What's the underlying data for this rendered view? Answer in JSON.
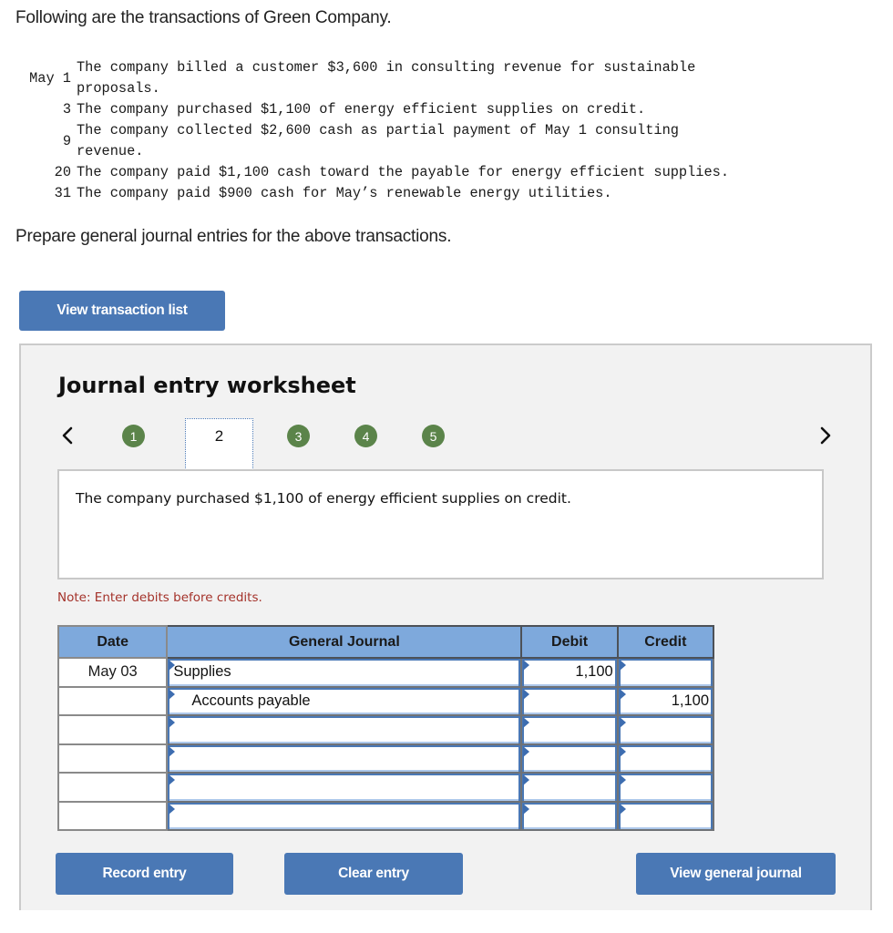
{
  "intro": "Following are the transactions of Green Company.",
  "transactions": [
    {
      "date": "May 1",
      "lines": [
        "The company billed a customer $3,600 in consulting revenue for sustainable",
        "proposals."
      ]
    },
    {
      "date": "3",
      "lines": [
        "The company purchased $1,100 of energy efficient supplies on credit."
      ]
    },
    {
      "date": "9",
      "lines": [
        "The company collected $2,600 cash as partial payment of May 1 consulting",
        "revenue."
      ]
    },
    {
      "date": "20",
      "lines": [
        "The company paid $1,100 cash toward the payable for energy efficient supplies."
      ]
    },
    {
      "date": "31",
      "lines": [
        "The company paid $900 cash for May’s renewable energy utilities."
      ]
    }
  ],
  "prompt": "Prepare general journal entries for the above transactions.",
  "buttons": {
    "view_transaction_list": "View transaction list",
    "record_entry": "Record entry",
    "clear_entry": "Clear entry",
    "view_general_journal": "View general journal"
  },
  "worksheet": {
    "title": "Journal entry worksheet",
    "steps": [
      "1",
      "2",
      "3",
      "4",
      "5"
    ],
    "active_step": "2",
    "description": "The company purchased $1,100 of energy efficient supplies on credit.",
    "note": "Note: Enter debits before credits."
  },
  "journal": {
    "headers": {
      "date": "Date",
      "account": "General Journal",
      "debit": "Debit",
      "credit": "Credit"
    },
    "rows": [
      {
        "date": "May 03",
        "account": "Supplies",
        "debit": "1,100",
        "credit": "",
        "indent": false
      },
      {
        "date": "",
        "account": "Accounts payable",
        "debit": "",
        "credit": "1,100",
        "indent": true
      },
      {
        "date": "",
        "account": "",
        "debit": "",
        "credit": "",
        "indent": false
      },
      {
        "date": "",
        "account": "",
        "debit": "",
        "credit": "",
        "indent": false
      },
      {
        "date": "",
        "account": "",
        "debit": "",
        "credit": "",
        "indent": false
      },
      {
        "date": "",
        "account": "",
        "debit": "",
        "credit": "",
        "indent": false
      }
    ]
  },
  "colors": {
    "button_blue": "#4a78b5",
    "step_green": "#5b844a",
    "header_blue": "#7ea9dc",
    "note_red": "#a4322a"
  }
}
